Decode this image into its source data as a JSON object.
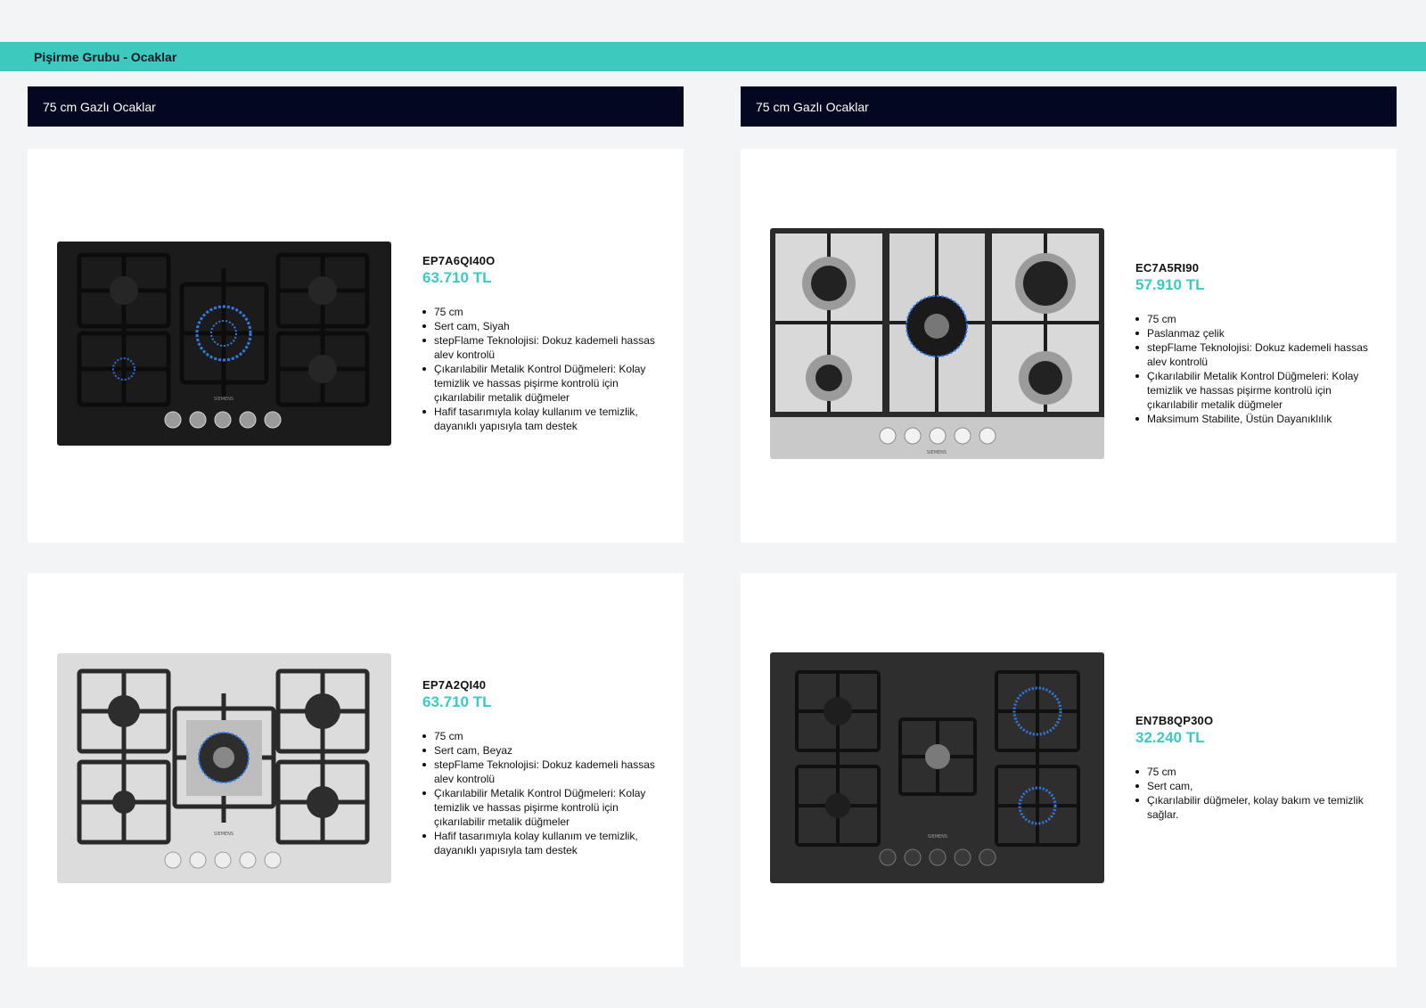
{
  "section_title": "Pişirme Grubu - Ocaklar",
  "columns": [
    {
      "header": "75 cm Gazlı Ocaklar"
    },
    {
      "header": "75 cm Gazlı Ocaklar"
    }
  ],
  "products": [
    {
      "model": "EP7A6QI40O",
      "price": "63.710 TL",
      "image_style": "black-glass",
      "features": [
        "75 cm",
        "Sert cam, Siyah",
        "stepFlame Teknolojisi: Dokuz kademeli hassas alev kontrolü",
        "Çıkarılabilir Metalik Kontrol Düğmeleri: Kolay temizlik ve hassas pişirme kontrolü için çıkarılabilir metalik düğmeler",
        "Hafif tasarımıyla kolay kullanım ve temizlik, dayanıklı yapısıyla tam destek"
      ]
    },
    {
      "model": "EC7A5RI90",
      "price": "57.910 TL",
      "image_style": "stainless",
      "features": [
        "75 cm",
        "Paslanmaz çelik",
        "stepFlame Teknolojisi: Dokuz kademeli hassas alev kontrolü",
        "Çıkarılabilir Metalik Kontrol Düğmeleri: Kolay temizlik ve hassas pişirme kontrolü için çıkarılabilir metalik düğmeler",
        "Maksimum Stabilite, Üstün Dayanıklılık"
      ]
    },
    {
      "model": "EP7A2QI40",
      "price": "63.710 TL",
      "image_style": "white-glass",
      "features": [
        "75 cm",
        "Sert cam, Beyaz",
        "stepFlame Teknolojisi: Dokuz kademeli hassas alev kontrolü",
        "Çıkarılabilir Metalik Kontrol Düğmeleri: Kolay temizlik ve hassas pişirme kontrolü için çıkarılabilir metalik düğmeler",
        "Hafif tasarımıyla kolay kullanım ve temizlik, dayanıklı yapısıyla tam destek"
      ]
    },
    {
      "model": "EN7B8QP30O",
      "price": "32.240 TL",
      "image_style": "dark-glass",
      "features": [
        "75 cm",
        "Sert cam,",
        "Çıkarılabilir düğmeler, kolay bakım ve temizlik sağlar."
      ]
    }
  ],
  "brand_mark": "SIEMENS",
  "colors": {
    "accent": "#3ec9bf",
    "header_bg": "#040720",
    "page_bg": "#f3f4f6"
  }
}
